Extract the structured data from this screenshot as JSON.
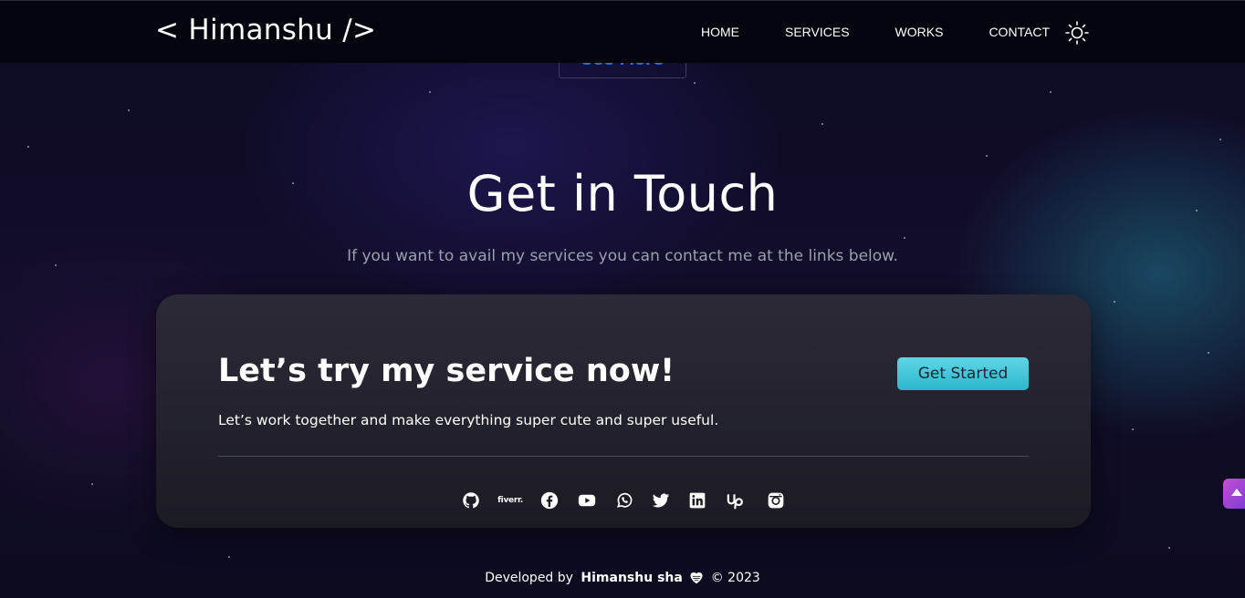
{
  "nav": {
    "logo": "< Himanshu />",
    "links": [
      "HOME",
      "SERVICES",
      "WORKS",
      "CONTACT"
    ],
    "theme_toggle_icon": "sun-icon"
  },
  "previous_section": {
    "see_more_label": "See More"
  },
  "contact": {
    "title": "Get in Touch",
    "subtitle": "If you want to avail my services you can contact me at the links below."
  },
  "cta": {
    "heading": "Let’s try my service now!",
    "text": "Let’s work together and make everything super cute and super useful.",
    "button_label": "Get Started",
    "button_color": "#3ec6da"
  },
  "socials": [
    {
      "name": "github-icon"
    },
    {
      "name": "fiverr-icon",
      "label": "fiverr."
    },
    {
      "name": "facebook-icon"
    },
    {
      "name": "youtube-icon"
    },
    {
      "name": "whatsapp-icon"
    },
    {
      "name": "twitter-icon"
    },
    {
      "name": "linkedin-icon"
    },
    {
      "name": "upwork-icon"
    },
    {
      "name": "instagram-icon"
    }
  ],
  "footer": {
    "prefix": "Developed by",
    "author": "Himanshu sha",
    "heart_icon": "heart-icon",
    "copyright": "© 2023"
  },
  "scroll_top_icon": "arrow-up-icon",
  "colors": {
    "accent": "#3ec6da",
    "background": "#0d0b26",
    "scroll_top": "#a346d4"
  }
}
